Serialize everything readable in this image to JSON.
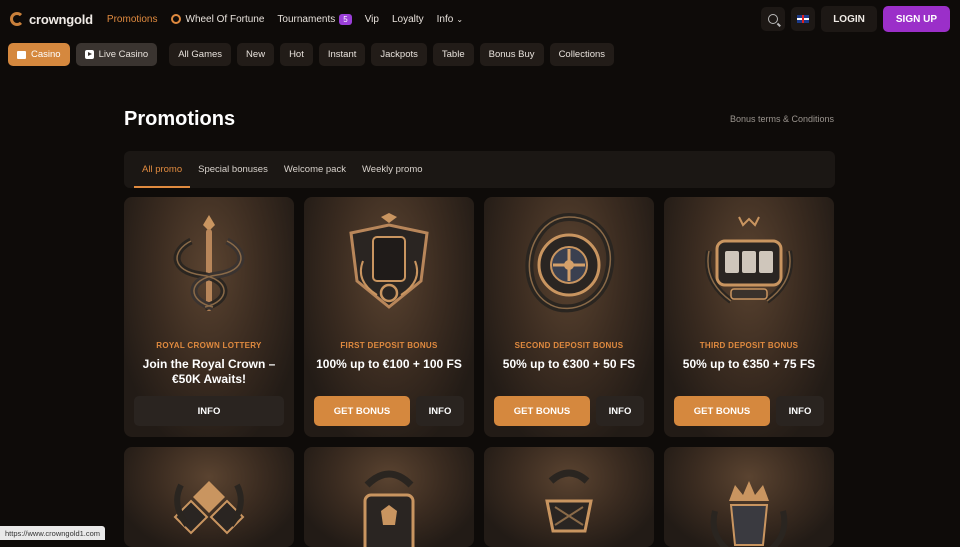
{
  "brand": {
    "name": "crowngold"
  },
  "nav": {
    "promotions": "Promotions",
    "wheel": "Wheel Of Fortune",
    "tournaments": "Tournaments",
    "tournaments_count": "5",
    "vip": "Vip",
    "loyalty": "Loyalty",
    "info": "Info"
  },
  "header": {
    "login": "LOGIN",
    "signup": "SIGN UP"
  },
  "categories": {
    "casino": "Casino",
    "live": "Live Casino",
    "items": [
      "All Games",
      "New",
      "Hot",
      "Instant",
      "Jackpots",
      "Table",
      "Bonus Buy",
      "Collections"
    ]
  },
  "page": {
    "title": "Promotions",
    "terms": "Bonus terms & Conditions"
  },
  "tabs": [
    "All promo",
    "Special bonuses",
    "Welcome pack",
    "Weekly promo"
  ],
  "cards": [
    {
      "tag": "ROYAL CROWN LOTTERY",
      "title": "Join the Royal Crown – €50K Awaits!",
      "info": "INFO"
    },
    {
      "tag": "FIRST DEPOSIT BONUS",
      "title": "100% up to €100 + 100 FS",
      "get": "GET BONUS",
      "info": "INFO"
    },
    {
      "tag": "SECOND DEPOSIT BONUS",
      "title": "50% up to €300 + 50 FS",
      "get": "GET BONUS",
      "info": "INFO"
    },
    {
      "tag": "THIRD DEPOSIT BONUS",
      "title": "50% up to €350 + 75 FS",
      "get": "GET BONUS",
      "info": "INFO"
    }
  ],
  "status_url": "https://www.crowngold1.com",
  "colors": {
    "accent": "#e08a3f",
    "signup": "#9b2fc9",
    "background": "#0e0b09"
  }
}
